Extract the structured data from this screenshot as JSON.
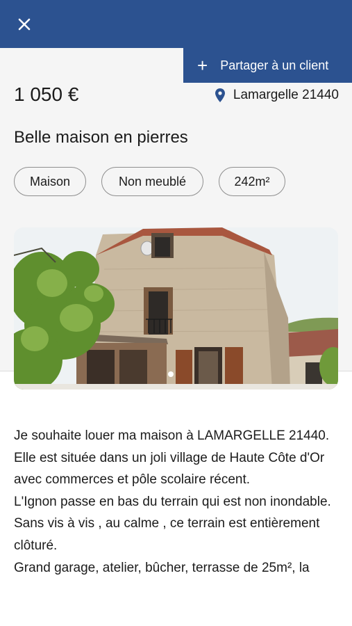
{
  "header": {
    "close_icon": "close-icon",
    "bar_color": "#2c5290"
  },
  "share": {
    "icon": "plus-icon",
    "label": "Partager à un client"
  },
  "listing": {
    "price": "1 050 €",
    "location_icon": "map-pin-icon",
    "location": "Lamargelle 21440",
    "title": "Belle maison en pierres",
    "tags": [
      "Maison",
      "Non meublé",
      "242m²"
    ],
    "photo_count_dots": 2,
    "description": [
      "Je souhaite louer ma maison à LAMARGELLE 21440.",
      "Elle est située dans un joli village de Haute Côte d'Or avec commerces et pôle scolaire récent.",
      "L'Ignon passe en bas du terrain qui est non inondable.",
      "Sans vis à vis , au calme , ce terrain est entièrement clôturé.",
      "Grand garage, atelier, bûcher, terrasse de 25m², la"
    ]
  }
}
